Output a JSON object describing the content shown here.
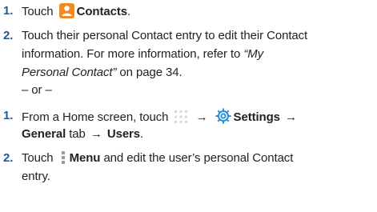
{
  "steps_a": [
    {
      "number": "1.",
      "pre": "Touch",
      "icon": "contacts-icon",
      "bold": "Contacts",
      "post": "."
    },
    {
      "number": "2.",
      "line1": "Touch their personal Contact entry to edit their Contact",
      "line2": "information. For more information, refer to ",
      "line2_italic": "“My",
      "line3_italic": "Personal Contact”",
      "line3_rest": " on page 34."
    }
  ],
  "separator": "– or –",
  "steps_b": [
    {
      "number": "1.",
      "pre": "From a Home screen, touch",
      "apps_icon": "apps-grid-icon",
      "arrow1": "→",
      "gear_icon": "settings-gear-icon",
      "bold1": "Settings",
      "arrow2": "→",
      "bold2": "General",
      "mid": " tab ",
      "arrow3": "→",
      "bold3": "Users",
      "post": "."
    },
    {
      "number": "2.",
      "pre": "Touch",
      "menu_icon": "menu-dots-icon",
      "bold": "Menu",
      "post": " and edit the user’s personal Contact",
      "line2": "entry."
    }
  ],
  "colors": {
    "number": "#1f5a96",
    "contacts_icon_bg": "#f08a24",
    "gear": "#2a8fd4"
  }
}
